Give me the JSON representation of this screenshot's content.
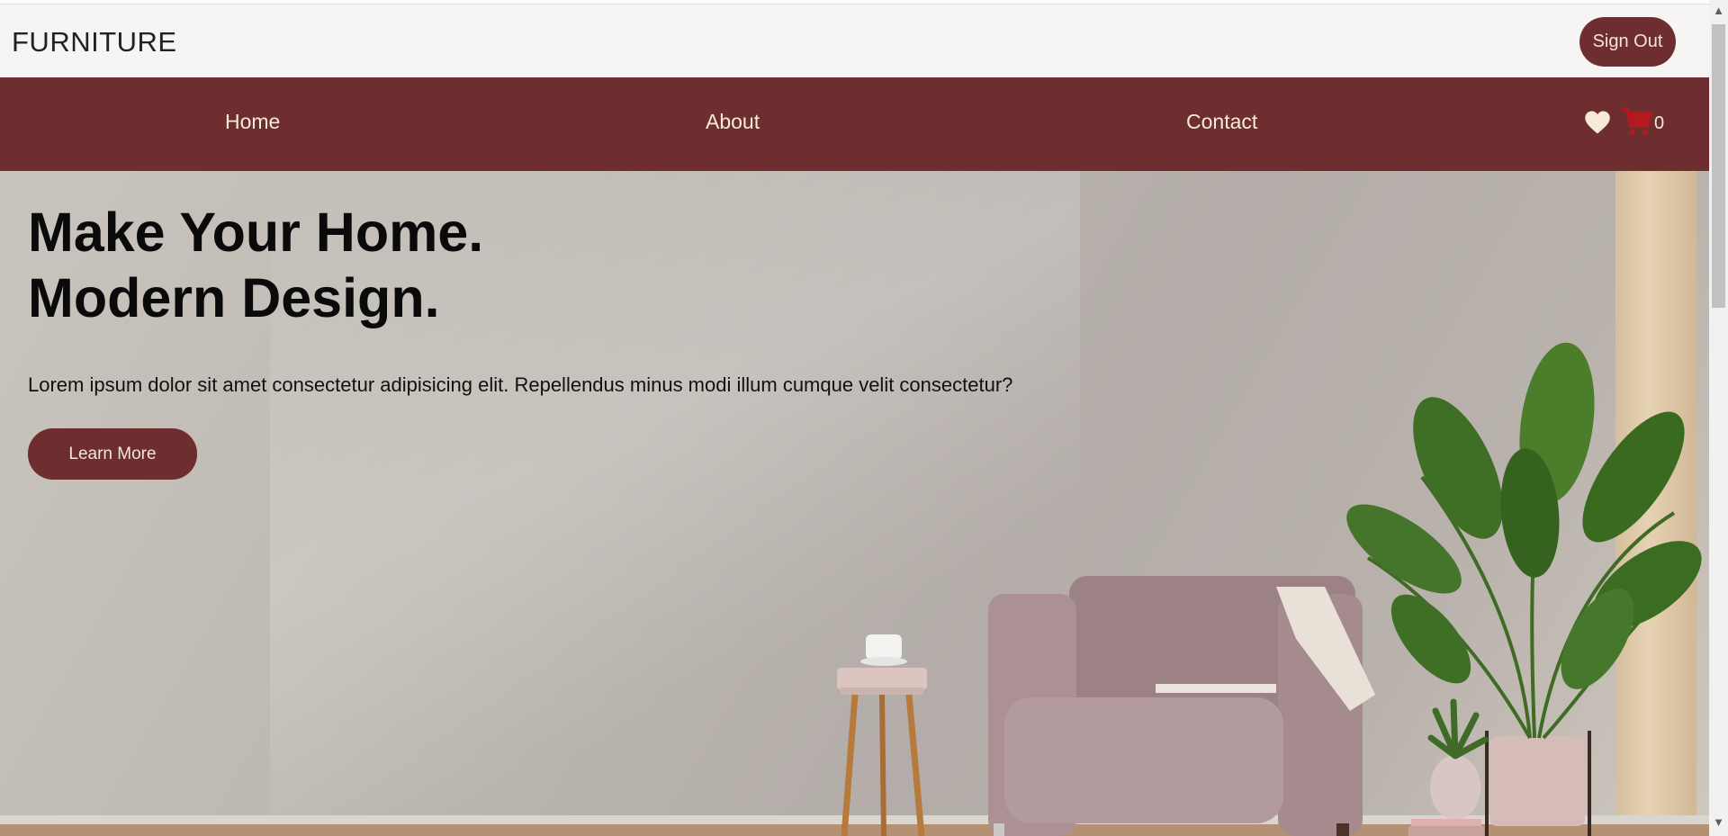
{
  "header": {
    "brand": "FURNITURE",
    "signout_label": "Sign Out"
  },
  "nav": {
    "items": [
      {
        "label": "Home"
      },
      {
        "label": "About"
      },
      {
        "label": "Contact"
      }
    ],
    "wishlist_icon": "heart-icon",
    "cart_icon": "cart-icon",
    "cart_count": "0"
  },
  "hero": {
    "title_line1": "Make Your Home.",
    "title_line2": "Modern Design.",
    "text": "Lorem ipsum dolor sit amet consectetur adipisicing elit. Repellendus minus modi illum cumque velit consectetur?",
    "button_label": "Learn More"
  },
  "colors": {
    "brand": "#6e2e30",
    "nav_text": "#f6ead9",
    "header_bg": "#f6f5f3"
  }
}
